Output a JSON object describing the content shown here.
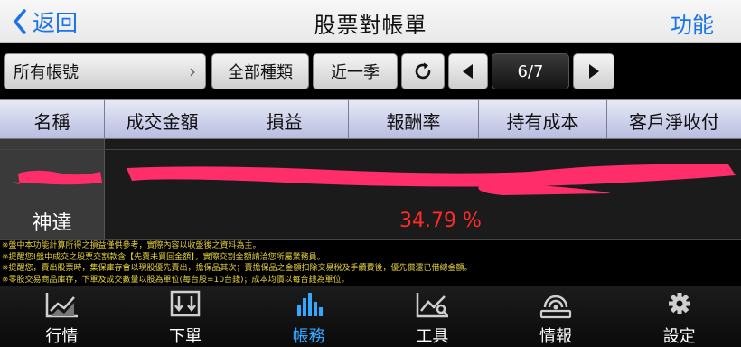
{
  "nav": {
    "back_label": "返回",
    "title": "股票對帳單",
    "func_label": "功能",
    "accent": "#1a73e8"
  },
  "toolbar": {
    "account": "所有帳號",
    "type": "全部種類",
    "period": "近一季",
    "page": "6/7",
    "icons": [
      "refresh-icon",
      "prev-arrow-icon",
      "next-arrow-icon"
    ]
  },
  "table": {
    "headers": [
      "名稱",
      "成交金額",
      "損益",
      "報酬率",
      "持有成本",
      "客戶淨收付"
    ],
    "rows": [
      {
        "name": "",
        "redacted": true
      },
      {
        "name": "神達",
        "return_rate": "34.79 %"
      }
    ],
    "profit_color": "#ff2a2a"
  },
  "notes": [
    "※盤中本功能計算所得之損益僅供參考，實際內容以收盤後之資料為主。",
    "※提醒您!盤中成交之股票交割款含【先賣未買回金額】，實際交割金額請洽您所屬業務員。",
    "※提醒您，賣出股票時，集保庫存會以現股優先賣出，擔保品其次；賣擔保品之金額扣除交易稅及手續費後，優先償還已借總金額。",
    "※零股交易商品庫存，下單及成交數量以股為單位(每台股=10台錢)；成本均價以每台錢為單位。"
  ],
  "tabs": [
    {
      "label": "行情",
      "icon": "line-chart-icon",
      "active": false
    },
    {
      "label": "下單",
      "icon": "order-icon",
      "active": false
    },
    {
      "label": "帳務",
      "icon": "bar-chart-icon",
      "active": true
    },
    {
      "label": "工具",
      "icon": "tools-icon",
      "active": false
    },
    {
      "label": "情報",
      "icon": "news-icon",
      "active": false
    },
    {
      "label": "設定",
      "icon": "gear-icon",
      "active": false
    }
  ],
  "active_color": "#34a7ff"
}
